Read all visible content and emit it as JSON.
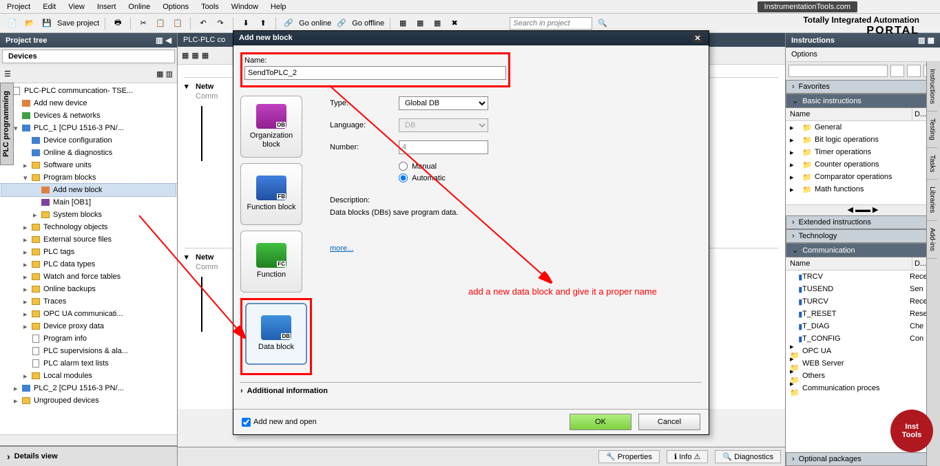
{
  "menubar": {
    "items": [
      "Project",
      "Edit",
      "View",
      "Insert",
      "Online",
      "Options",
      "Tools",
      "Window",
      "Help"
    ]
  },
  "watermark": "InstrumentationTools.com",
  "portal": {
    "top": "Totally Integrated Automation",
    "bottom": "PORTAL"
  },
  "toolbar": {
    "save_label": "Save project",
    "go_online": "Go online",
    "go_offline": "Go offline",
    "search_ph": "Search in project"
  },
  "left": {
    "title": "Project tree",
    "devices_tab": "Devices",
    "tree": [
      {
        "lvl": 0,
        "exp": "▾",
        "ic": "page",
        "txt": "PLC-PLC communcation- TSE..."
      },
      {
        "lvl": 1,
        "exp": "",
        "ic": "orange",
        "txt": "Add new device"
      },
      {
        "lvl": 1,
        "exp": "",
        "ic": "green",
        "txt": "Devices & networks"
      },
      {
        "lvl": 1,
        "exp": "▾",
        "ic": "blue",
        "txt": "PLC_1 [CPU 1516-3 PN/..."
      },
      {
        "lvl": 2,
        "exp": "",
        "ic": "blue",
        "txt": "Device configuration"
      },
      {
        "lvl": 2,
        "exp": "",
        "ic": "blue",
        "txt": "Online & diagnostics"
      },
      {
        "lvl": 2,
        "exp": "▸",
        "ic": "folder",
        "txt": "Software units"
      },
      {
        "lvl": 2,
        "exp": "▾",
        "ic": "folder",
        "txt": "Program blocks"
      },
      {
        "lvl": 3,
        "exp": "",
        "ic": "orange",
        "txt": "Add new block",
        "sel": true
      },
      {
        "lvl": 3,
        "exp": "",
        "ic": "purple",
        "txt": "Main [OB1]"
      },
      {
        "lvl": 3,
        "exp": "▸",
        "ic": "folder",
        "txt": "System blocks"
      },
      {
        "lvl": 2,
        "exp": "▸",
        "ic": "folder",
        "txt": "Technology objects"
      },
      {
        "lvl": 2,
        "exp": "▸",
        "ic": "folder",
        "txt": "External source files"
      },
      {
        "lvl": 2,
        "exp": "▸",
        "ic": "folder",
        "txt": "PLC tags"
      },
      {
        "lvl": 2,
        "exp": "▸",
        "ic": "folder",
        "txt": "PLC data types"
      },
      {
        "lvl": 2,
        "exp": "▸",
        "ic": "folder",
        "txt": "Watch and force tables"
      },
      {
        "lvl": 2,
        "exp": "▸",
        "ic": "folder",
        "txt": "Online backups"
      },
      {
        "lvl": 2,
        "exp": "▸",
        "ic": "folder",
        "txt": "Traces"
      },
      {
        "lvl": 2,
        "exp": "▸",
        "ic": "folder",
        "txt": "OPC UA communicati..."
      },
      {
        "lvl": 2,
        "exp": "▸",
        "ic": "folder",
        "txt": "Device proxy data"
      },
      {
        "lvl": 2,
        "exp": "",
        "ic": "page",
        "txt": "Program info"
      },
      {
        "lvl": 2,
        "exp": "",
        "ic": "page",
        "txt": "PLC supervisions & ala..."
      },
      {
        "lvl": 2,
        "exp": "",
        "ic": "page",
        "txt": "PLC alarm text lists"
      },
      {
        "lvl": 2,
        "exp": "▸",
        "ic": "folder",
        "txt": "Local modules"
      },
      {
        "lvl": 1,
        "exp": "▸",
        "ic": "blue",
        "txt": "PLC_2 [CPU 1516-3 PN/..."
      },
      {
        "lvl": 1,
        "exp": "▸",
        "ic": "folder",
        "txt": "Ungrouped devices"
      }
    ],
    "details": "Details view"
  },
  "sidetab": "PLC programming",
  "center": {
    "tab": "PLC-PLC co",
    "network1": {
      "title": "Netw",
      "comment": "Comm"
    },
    "network2": {
      "title": "Netw",
      "comment": "Comm"
    },
    "footer": {
      "properties": "Properties",
      "info": "Info",
      "diag": "Diagnostics"
    }
  },
  "right": {
    "title": "Instructions",
    "options": "Options",
    "sections": {
      "favorites": "Favorites",
      "basic": "Basic instructions",
      "extended": "Extended instructions",
      "technology": "Technology",
      "communication": "Communication"
    },
    "cols": {
      "name": "Name",
      "d": "D..."
    },
    "basic_items": [
      {
        "ic": "folder",
        "txt": "General",
        "d": ""
      },
      {
        "ic": "folder-y",
        "txt": "Bit logic operations",
        "d": ""
      },
      {
        "ic": "folder-y",
        "txt": "Timer operations",
        "d": ""
      },
      {
        "ic": "folder-y",
        "txt": "Counter operations",
        "d": ""
      },
      {
        "ic": "folder-y",
        "txt": "Comparator operations",
        "d": ""
      },
      {
        "ic": "folder-y",
        "txt": "Math functions",
        "d": ""
      }
    ],
    "comm_items": [
      {
        "ic": "blk",
        "txt": "TRCV",
        "d": "Rece"
      },
      {
        "ic": "blk",
        "txt": "TUSEND",
        "d": "Sen"
      },
      {
        "ic": "blk",
        "txt": "TURCV",
        "d": "Rece"
      },
      {
        "ic": "blk",
        "txt": "T_RESET",
        "d": "Rese"
      },
      {
        "ic": "blk",
        "txt": "T_DIAG",
        "d": "Che"
      },
      {
        "ic": "blk",
        "txt": "T_CONFIG",
        "d": "Con"
      },
      {
        "ic": "folder",
        "txt": "OPC UA",
        "d": ""
      },
      {
        "ic": "folder",
        "txt": "WEB Server",
        "d": ""
      },
      {
        "ic": "folder",
        "txt": "Others",
        "d": ""
      },
      {
        "ic": "folder",
        "txt": "Communication proces",
        "d": ""
      }
    ],
    "optional": "Optional packages",
    "tabs": [
      "Instructions",
      "Testing",
      "Tasks",
      "Libraries",
      "Add-ins"
    ]
  },
  "dialog": {
    "title": "Add new block",
    "name_label": "Name:",
    "name_value": "SendToPLC_2",
    "blocks": {
      "ob": "Organization block",
      "fb": "Function block",
      "fc": "Function",
      "db": "Data block"
    },
    "type_label": "Type:",
    "type_value": "Global DB",
    "lang_label": "Language:",
    "lang_value": "DB",
    "num_label": "Number:",
    "num_value": "4",
    "manual": "Manual",
    "automatic": "Automatic",
    "desc_label": "Description:",
    "desc_text": "Data blocks (DBs) save program data.",
    "more": "more...",
    "addl": "Additional information",
    "add_open": "Add new and open",
    "ok": "OK",
    "cancel": "Cancel"
  },
  "annotation": "add a new data block and give it a proper name",
  "badge": {
    "l1": "Inst",
    "l2": "Tools"
  }
}
